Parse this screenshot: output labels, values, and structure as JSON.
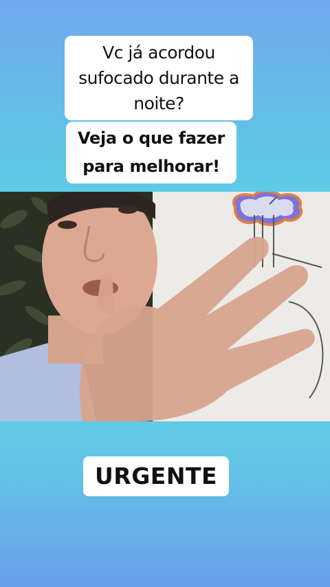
{
  "captions": {
    "question": [
      "Vc já acordou",
      "sufocado durante a",
      "noite?"
    ],
    "cta": [
      "Veja o que fazer",
      "para melhorar!"
    ],
    "urgent": "URGENTE"
  },
  "colors": {
    "background_top": "#6fa8ec",
    "background_middle": "#5fd6e4",
    "caption_bg": "#ffffff",
    "caption_text": "#111111"
  }
}
